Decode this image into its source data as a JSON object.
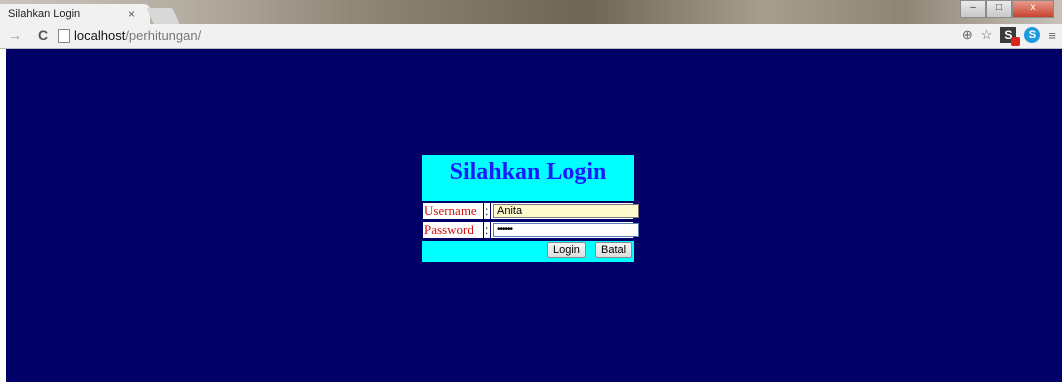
{
  "browser": {
    "tab_title": "Silahkan Login",
    "tab_close": "×",
    "url_host": "localhost",
    "url_path": "/perhitungan/",
    "window_controls": [
      "–",
      "□",
      "x"
    ]
  },
  "login": {
    "title": "Silahkan Login",
    "username_label": "Username",
    "password_label": "Password",
    "colon": ":",
    "username_value": "Anita",
    "password_value": "••••••",
    "login_button": "Login",
    "cancel_button": "Batal"
  },
  "colors": {
    "page_background": "#000066",
    "header_background": "#00ffff",
    "title_color": "#1a1aff",
    "label_color": "#d01010"
  }
}
